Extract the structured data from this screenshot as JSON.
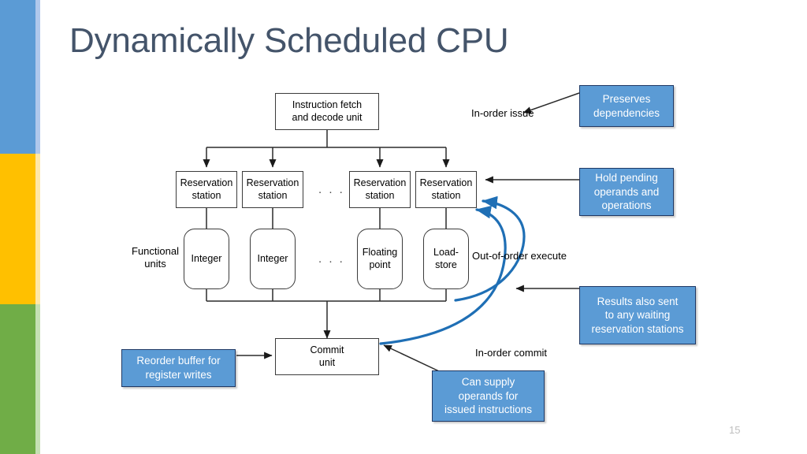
{
  "slide": {
    "title": "Dynamically Scheduled CPU",
    "page_number": "15",
    "title_color": "#44546A",
    "background": "#ffffff"
  },
  "stripe": {
    "blue": "#5B9BD5",
    "yellow": "#FFC000",
    "green": "#70AD47"
  },
  "diagram": {
    "fetch_unit": "Instruction fetch\nand decode unit",
    "reservation_stations": [
      "Reservation\nstation",
      "Reservation\nstation",
      "Reservation\nstation",
      "Reservation\nstation"
    ],
    "functional_units": [
      "Integer",
      "Integer",
      "Floating\npoint",
      "Load-\nstore"
    ],
    "functional_units_label": "Functional\nunits",
    "commit_unit": "Commit\nunit",
    "ellipsis_rs": ". . .",
    "ellipsis_fu": ". . ."
  },
  "annotations": {
    "in_order_issue": "In-order issue",
    "out_of_order_execute": "Out-of-order execute",
    "in_order_commit": "In-order commit"
  },
  "callouts": {
    "preserves_dependencies": "Preserves\ndependencies",
    "hold_pending": "Hold pending\noperands and\noperations",
    "results_also_sent": "Results also sent\nto any waiting\nreservation stations",
    "reorder_buffer": "Reorder buffer for\nregister writes",
    "can_supply_operands": "Can supply\noperands for\nissued instructions",
    "fill_color": "#5B9BD5",
    "border_color": "#1F3864",
    "text_color": "#FFFFFF"
  }
}
